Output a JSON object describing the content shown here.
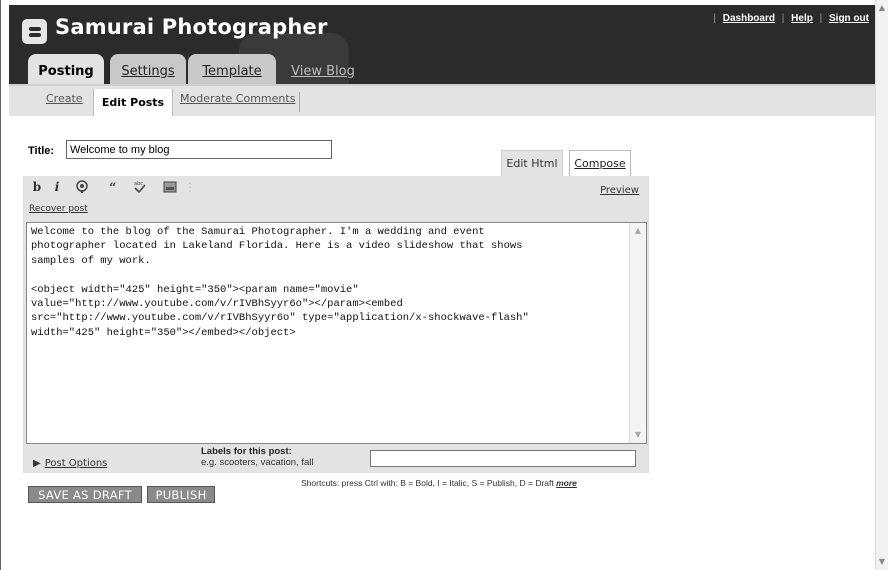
{
  "header": {
    "blog_title": "Samurai Photographer",
    "links": [
      "Dashboard",
      "Help",
      "Sign out"
    ]
  },
  "tabs": [
    {
      "label": "Posting",
      "active": true
    },
    {
      "label": "Settings",
      "active": false
    },
    {
      "label": "Template",
      "active": false
    },
    {
      "label": "View Blog",
      "active": false
    }
  ],
  "subnav": {
    "create": "Create",
    "edit_posts": "Edit Posts",
    "moderate": "Moderate Comments"
  },
  "post": {
    "title_label": "Title:",
    "title_value": "Welcome to my blog",
    "body": "Welcome to the blog of the Samurai Photographer. I'm a wedding and event\nphotographer located in Lakeland Florida. Here is a video slideshow that shows\nsamples of my work.\n\n<object width=\"425\" height=\"350\"><param name=\"movie\"\nvalue=\"http://www.youtube.com/v/rIVBhSyyr6o\"></param><embed\nsrc=\"http://www.youtube.com/v/rIVBhSyyr6o\" type=\"application/x-shockwave-flash\"\nwidth=\"425\" height=\"350\"></embed></object>"
  },
  "editor": {
    "mode_tabs": [
      "Edit Html",
      "Compose"
    ],
    "active_mode": "Edit Html",
    "toolbar_icons": [
      "bold-icon",
      "italic-icon",
      "link-icon",
      "blockquote-icon",
      "spellcheck-icon",
      "image-icon"
    ],
    "bold_glyph": "b",
    "italic_glyph": "i",
    "preview": "Preview",
    "recover": "Recover post"
  },
  "footer": {
    "post_options": "Post Options",
    "labels_title": "Labels for this post:",
    "labels_hint": "e.g. scooters, vacation, fall",
    "labels_value": "",
    "save_draft": "SAVE AS DRAFT",
    "publish": "PUBLISH",
    "shortcuts_text": "Shortcuts: press Ctrl with: B = Bold, I = Italic, S = Publish, D = Draft",
    "shortcuts_more": "more"
  }
}
